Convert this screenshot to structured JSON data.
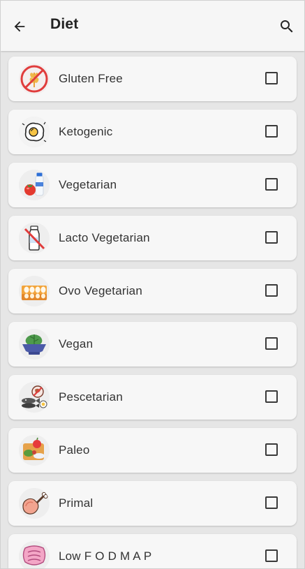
{
  "header": {
    "title": "Diet",
    "back_icon": "arrow-left-icon",
    "search_icon": "search-icon"
  },
  "diets": [
    {
      "label": "Gluten Free",
      "icon": "no-gluten-icon",
      "checked": false
    },
    {
      "label": "Ketogenic",
      "icon": "fried-egg-icon",
      "checked": false
    },
    {
      "label": "Vegetarian",
      "icon": "milk-tomato-icon",
      "checked": false
    },
    {
      "label": "Lacto Vegetarian",
      "icon": "no-milk-icon",
      "checked": false
    },
    {
      "label": "Ovo Vegetarian",
      "icon": "egg-carton-icon",
      "checked": false
    },
    {
      "label": "Vegan",
      "icon": "salad-bowl-icon",
      "checked": false
    },
    {
      "label": "Pescetarian",
      "icon": "fish-no-meat-icon",
      "checked": false
    },
    {
      "label": "Paleo",
      "icon": "paleo-food-icon",
      "checked": false
    },
    {
      "label": "Primal",
      "icon": "meat-leg-icon",
      "checked": false
    },
    {
      "label": "Low F O D M A P",
      "icon": "intestine-icon",
      "checked": false
    }
  ],
  "colors": {
    "appbar": "#f6f6f6",
    "background": "#e6e6e6",
    "card": "#f7f7f7",
    "text": "#333333",
    "red_accent": "#e03c3c"
  }
}
